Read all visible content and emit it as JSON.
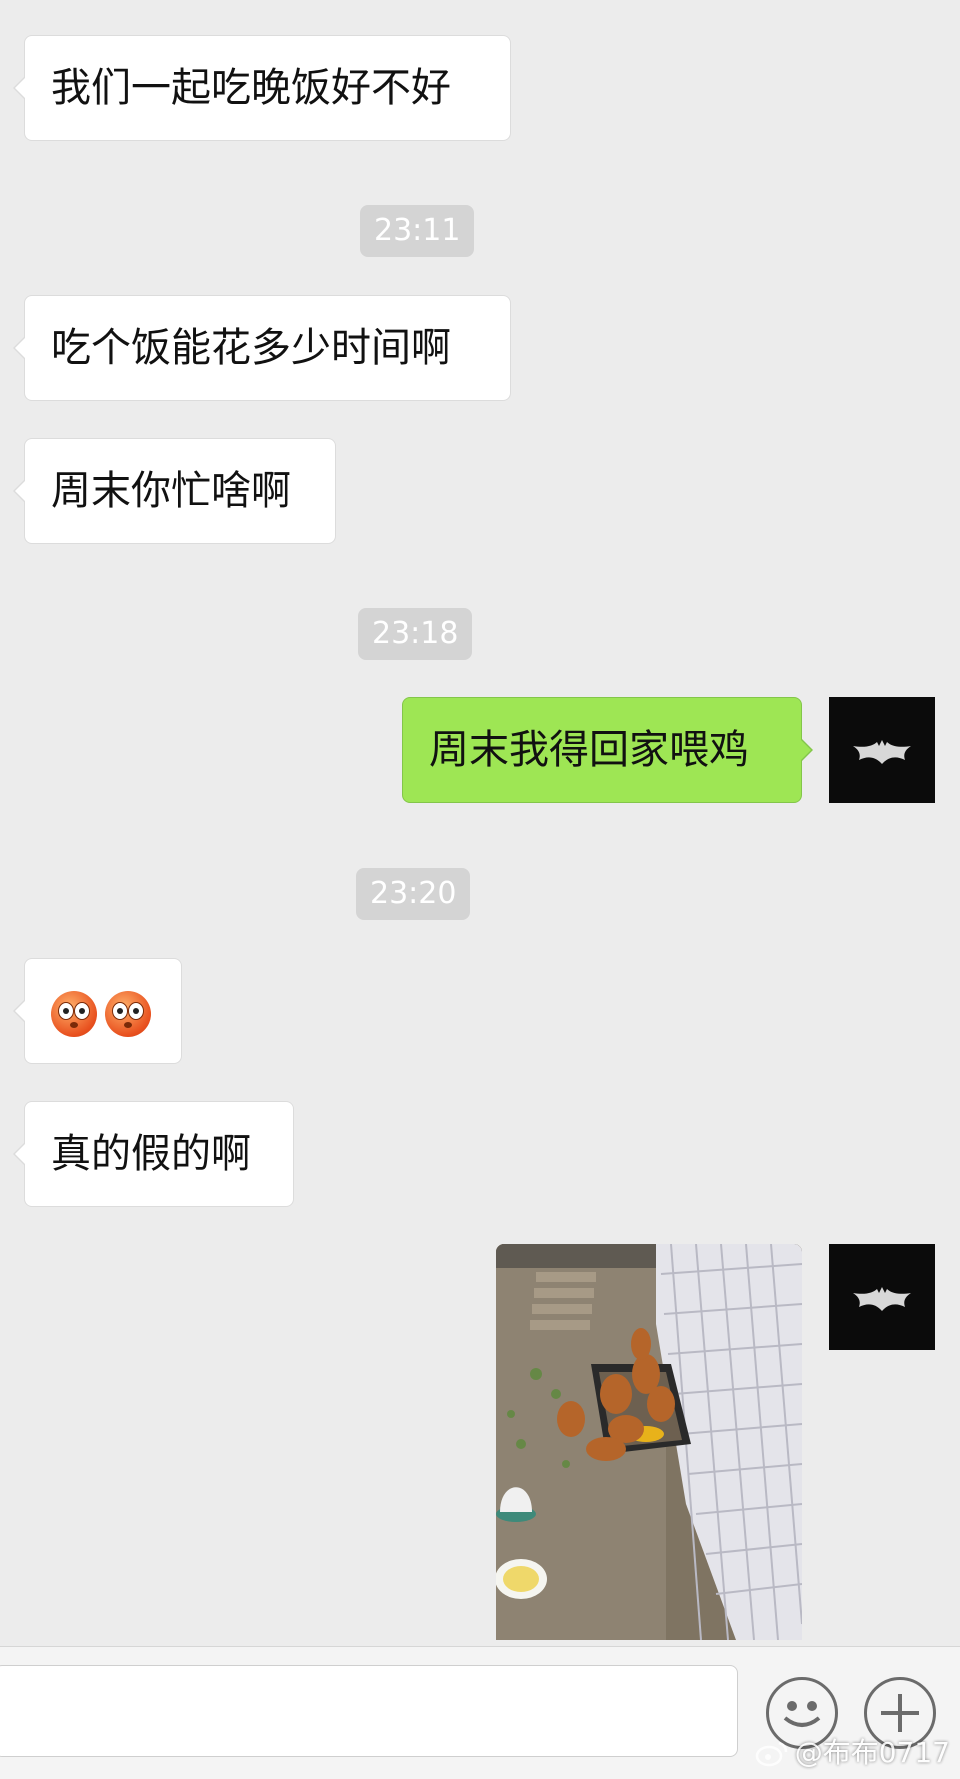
{
  "messages": [
    {
      "side": "in",
      "text": "我们一起吃晚饭好不好"
    },
    {
      "timestamp": "23:11"
    },
    {
      "side": "in",
      "text": "吃个饭能花多少时间啊"
    },
    {
      "side": "in",
      "text": "周末你忙啥啊"
    },
    {
      "timestamp": "23:18"
    },
    {
      "side": "out",
      "text": "周末我得回家喂鸡"
    },
    {
      "timestamp": "23:20"
    },
    {
      "side": "in",
      "emoji": "flushed-face-emoji x2"
    },
    {
      "side": "in",
      "text": "真的假的啊"
    },
    {
      "side": "out",
      "image": "chickens-photo"
    }
  ],
  "chat": {
    "msg1": "我们一起吃晚饭好不好",
    "time1": "23:11",
    "msg2": "吃个饭能花多少时间啊",
    "msg3": "周末你忙啥啊",
    "time2": "23:18",
    "msg4": "周末我得回家喂鸡",
    "time3": "23:20",
    "msg6": "真的假的啊"
  },
  "icons": {
    "avatar": "batman-logo-icon",
    "emoji_button": "smiley-face-icon",
    "plus_button": "plus-icon",
    "watermark_logo": "weibo-icon"
  },
  "watermark": {
    "text": "@布布0717"
  },
  "colors": {
    "background": "#ececec",
    "incoming_bubble": "#ffffff",
    "outgoing_bubble": "#9ee654",
    "timestamp_pill": "#d4d4d4"
  }
}
